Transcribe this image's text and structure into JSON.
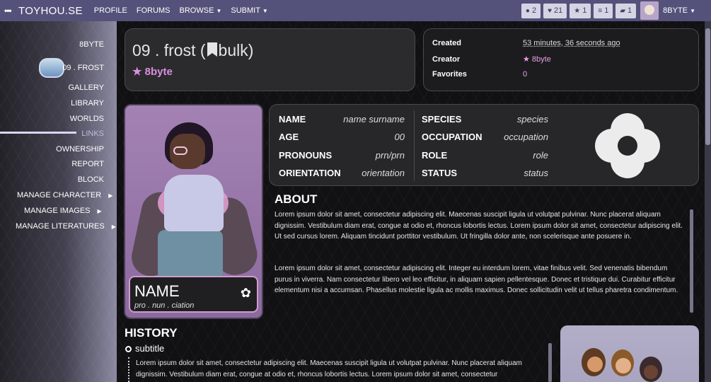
{
  "navbar": {
    "brand": "TOYHOU.SE",
    "links": [
      "PROFILE",
      "FORUMS",
      "BROWSE",
      "SUBMIT"
    ],
    "pills": [
      {
        "icon": "comment-icon",
        "count": "2"
      },
      {
        "icon": "heart-icon",
        "count": "21"
      },
      {
        "icon": "star-icon",
        "count": "1"
      },
      {
        "icon": "list-icon",
        "count": "1"
      },
      {
        "icon": "chat-icon",
        "count": "1"
      }
    ],
    "user": "8BYTE"
  },
  "sidebar": {
    "owner": "8BYTE",
    "character": "09 . FROST",
    "items": [
      "GALLERY",
      "LIBRARY",
      "WORLDS",
      "LINKS",
      "OWNERSHIP",
      "REPORT",
      "BLOCK"
    ],
    "active": "LINKS",
    "submenus": [
      "MANAGE CHARACTER",
      "MANAGE IMAGES",
      "MANAGE LITERATURES"
    ]
  },
  "header": {
    "title": "09 . frost (",
    "title_tag": "bulk)",
    "owner": "8byte"
  },
  "meta": {
    "created_label": "Created",
    "created_value": "53 minutes, 36 seconds ago",
    "creator_label": "Creator",
    "creator_value": "8byte",
    "favorites_label": "Favorites",
    "favorites_value": "0"
  },
  "nameplate": {
    "name": "NAME",
    "pronunciation": "pro . nun . ciation"
  },
  "info": {
    "left": [
      {
        "label": "NAME",
        "value": "name surname"
      },
      {
        "label": "AGE",
        "value": "00"
      },
      {
        "label": "PRONOUNS",
        "value": "prn/prn"
      },
      {
        "label": "ORIENTATION",
        "value": "orientation"
      }
    ],
    "right": [
      {
        "label": "SPECIES",
        "value": "species"
      },
      {
        "label": "OCCUPATION",
        "value": "occupation"
      },
      {
        "label": "ROLE",
        "value": "role"
      },
      {
        "label": "STATUS",
        "value": "status"
      }
    ]
  },
  "about": {
    "heading": "ABOUT",
    "p1": "Lorem ipsum dolor sit amet, consectetur adipiscing elit. Maecenas suscipit ligula ut volutpat pulvinar. Nunc placerat aliquam dignissim. Vestibulum diam erat, congue at odio et, rhoncus lobortis lectus. Lorem ipsum dolor sit amet, consectetur adipiscing elit. Ut sed cursus lorem. Aliquam tincidunt porttitor vestibulum. Ut fringilla dolor ante, non scelerisque ante posuere in.",
    "p2": "Lorem ipsum dolor sit amet, consectetur adipiscing elit. Integer eu interdum lorem, vitae finibus velit. Sed venenatis bibendum purus in viverra. Nam consectetur libero vel leo efficitur, in aliquam sapien pellentesque. Donec et tristique dui. Curabitur efficitur elementum nisi a accumsan. Phasellus molestie ligula ac mollis maximus. Donec sollicitudin velit ut tellus pharetra condimentum."
  },
  "history": {
    "heading": "HISTORY",
    "subtitle": "subtitle",
    "p1": "Lorem ipsum dolor sit amet, consectetur adipiscing elit. Maecenas suscipit ligula ut volutpat pulvinar. Nunc placerat aliquam dignissim. Vestibulum diam erat, congue at odio et, rhoncus lobortis lectus. Lorem ipsum dolor sit amet, consectetur"
  }
}
